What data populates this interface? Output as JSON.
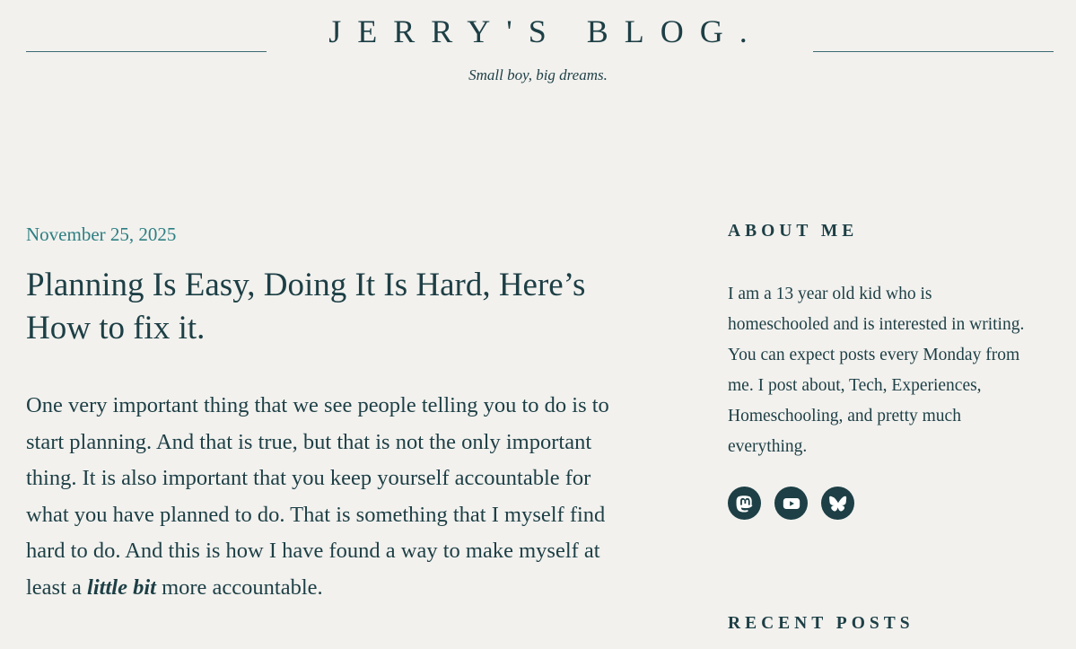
{
  "site": {
    "title": "JERRY'S BLOG.",
    "tagline": "Small boy, big dreams."
  },
  "post": {
    "date": "November 25, 2025",
    "title": "Planning Is Easy, Doing It Is Hard, Here’s How to fix it.",
    "body_before": "One very important thing that we see people telling you to do is to start planning. And that is true, but that is not the only important thing. It is also important that you keep yourself accountable for what you have planned to do. That is something that I myself find hard to do. And this is how I have found a way to make myself at least a ",
    "body_emphasis": "little bit",
    "body_after": " more accountable."
  },
  "sidebar": {
    "about_title": "ABOUT ME",
    "about_text": "I am a 13 year old kid who is homeschooled and is interested in writing. You can expect posts every Monday from me. I post about, Tech, Experiences, Homeschooling, and pretty much everything.",
    "social_icons": [
      "mastodon-icon",
      "youtube-icon",
      "bluesky-icon"
    ],
    "recent_title": "RECENT POSTS"
  },
  "colors": {
    "background": "#f2f1ee",
    "text": "#1d3f45",
    "accent": "#2d7f82"
  }
}
